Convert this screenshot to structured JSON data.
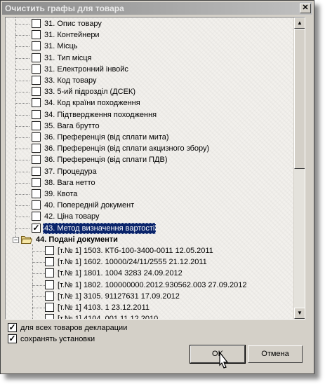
{
  "window": {
    "title": "Очистить графы для товара",
    "close_symbol": "✕"
  },
  "tree": {
    "items": [
      {
        "label": "31. Опис товару",
        "checked": false
      },
      {
        "label": "31. Контейнери",
        "checked": false
      },
      {
        "label": "31. Місць",
        "checked": false
      },
      {
        "label": "31. Тип місця",
        "checked": false
      },
      {
        "label": "31. Електронний інвойс",
        "checked": false
      },
      {
        "label": "33. Код товару",
        "checked": false
      },
      {
        "label": "33. 5-ий підрозділ (ДСЕК)",
        "checked": false
      },
      {
        "label": "34. Код країни походження",
        "checked": false
      },
      {
        "label": "34. Підтвердження походження",
        "checked": false
      },
      {
        "label": "35. Вага брутто",
        "checked": false
      },
      {
        "label": "36. Преференція (від сплати мита)",
        "checked": false
      },
      {
        "label": "36. Преференція (від сплати акцизного збору)",
        "checked": false
      },
      {
        "label": "36. Преференція (від сплати ПДВ)",
        "checked": false
      },
      {
        "label": "37. Процедура",
        "checked": false
      },
      {
        "label": "38. Вага нетто",
        "checked": false
      },
      {
        "label": "39. Квота",
        "checked": false
      },
      {
        "label": "40. Попередній документ",
        "checked": false
      },
      {
        "label": "42. Ціна товару",
        "checked": false
      },
      {
        "label": "43. Метод визначення вартості",
        "checked": true,
        "selected": true
      }
    ],
    "group": {
      "label": "44. Подані документи",
      "children": [
        "[т.№ 1] 1503. КТб-100-3400-0011 12.05.2011",
        "[т.№ 1] 1602. 10000/24/11/2555 21.12.2011",
        "[т.№ 1] 1801. 1004 3283 24.09.2012",
        "[т.№ 1] 1802. 100000000.2012.930562.003 27.09.2012",
        "[т.№ 1] 3105. 91127631 17.09.2012",
        "[т.№ 1] 4103. 1 23.12.2011",
        "[т.№ 1] 4104. 001 11.12.2010"
      ]
    },
    "check_mark": "✓",
    "minus_symbol": "−"
  },
  "scrollbar": {
    "up_arrow": "▲",
    "down_arrow": "▼"
  },
  "options": [
    {
      "label": "для всех товаров декларации",
      "checked": true
    },
    {
      "label": "сохранять установки",
      "checked": true
    }
  ],
  "buttons": {
    "ok": "OK",
    "cancel": "Отмена"
  }
}
